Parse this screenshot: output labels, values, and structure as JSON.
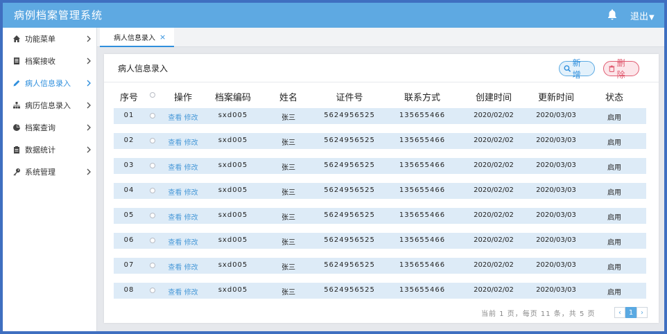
{
  "app": {
    "title": "病例档案管理系统",
    "logout": "退出",
    "logout_caret": "▼",
    "bell_icon": "bell-icon"
  },
  "colors": {
    "header": "#5ea9e2",
    "accent": "#2f8fdd",
    "border": "#3f6fc0",
    "row_bg": "#ddebf7",
    "danger": "#e05b70"
  },
  "sidebar": {
    "items": [
      {
        "label": "功能菜单",
        "icon": "home-icon",
        "active": false
      },
      {
        "label": "档案接收",
        "icon": "document-icon",
        "active": false
      },
      {
        "label": "病人信息录入",
        "icon": "pencil-icon",
        "active": true
      },
      {
        "label": "病历信息录入",
        "icon": "sitemap-icon",
        "active": false
      },
      {
        "label": "档案查询",
        "icon": "pie-chart-icon",
        "active": false
      },
      {
        "label": "数据统计",
        "icon": "clipboard-icon",
        "active": false
      },
      {
        "label": "系统管理",
        "icon": "key-icon",
        "active": false
      }
    ]
  },
  "tabs": [
    {
      "label": "病人信息录入",
      "close": "×",
      "active": true
    }
  ],
  "card": {
    "title": "病人信息录入",
    "add_label": "新增",
    "delete_label": "删除"
  },
  "table": {
    "headers": [
      "序号",
      "",
      "操作",
      "档案编码",
      "姓名",
      "证件号",
      "联系方式",
      "创建时间",
      "更新时间",
      "状态"
    ],
    "view_label": "查看",
    "edit_label": "修改",
    "rows": [
      {
        "index": "01",
        "code": "sxd005",
        "name": "张三",
        "id_no": "5624956525",
        "phone": "135655466",
        "created": "2020/02/02",
        "updated": "2020/03/03",
        "status": "启用"
      },
      {
        "index": "02",
        "code": "sxd005",
        "name": "张三",
        "id_no": "5624956525",
        "phone": "135655466",
        "created": "2020/02/02",
        "updated": "2020/03/03",
        "status": "启用"
      },
      {
        "index": "03",
        "code": "sxd005",
        "name": "张三",
        "id_no": "5624956525",
        "phone": "135655466",
        "created": "2020/02/02",
        "updated": "2020/03/03",
        "status": "启用"
      },
      {
        "index": "04",
        "code": "sxd005",
        "name": "张三",
        "id_no": "5624956525",
        "phone": "135655466",
        "created": "2020/02/02",
        "updated": "2020/03/03",
        "status": "启用"
      },
      {
        "index": "05",
        "code": "sxd005",
        "name": "张三",
        "id_no": "5624956525",
        "phone": "135655466",
        "created": "2020/02/02",
        "updated": "2020/03/03",
        "status": "启用"
      },
      {
        "index": "06",
        "code": "sxd005",
        "name": "张三",
        "id_no": "5624956525",
        "phone": "135655466",
        "created": "2020/02/02",
        "updated": "2020/03/03",
        "status": "启用"
      },
      {
        "index": "07",
        "code": "sxd005",
        "name": "张三",
        "id_no": "5624956525",
        "phone": "135655466",
        "created": "2020/02/02",
        "updated": "2020/03/03",
        "status": "启用"
      },
      {
        "index": "08",
        "code": "sxd005",
        "name": "张三",
        "id_no": "5624956525",
        "phone": "135655466",
        "created": "2020/02/02",
        "updated": "2020/03/03",
        "status": "启用"
      }
    ]
  },
  "pagination": {
    "summary": "当前 1 页，每页 11 条，共 5 页",
    "prev": "‹",
    "current": "1",
    "next": "›"
  }
}
